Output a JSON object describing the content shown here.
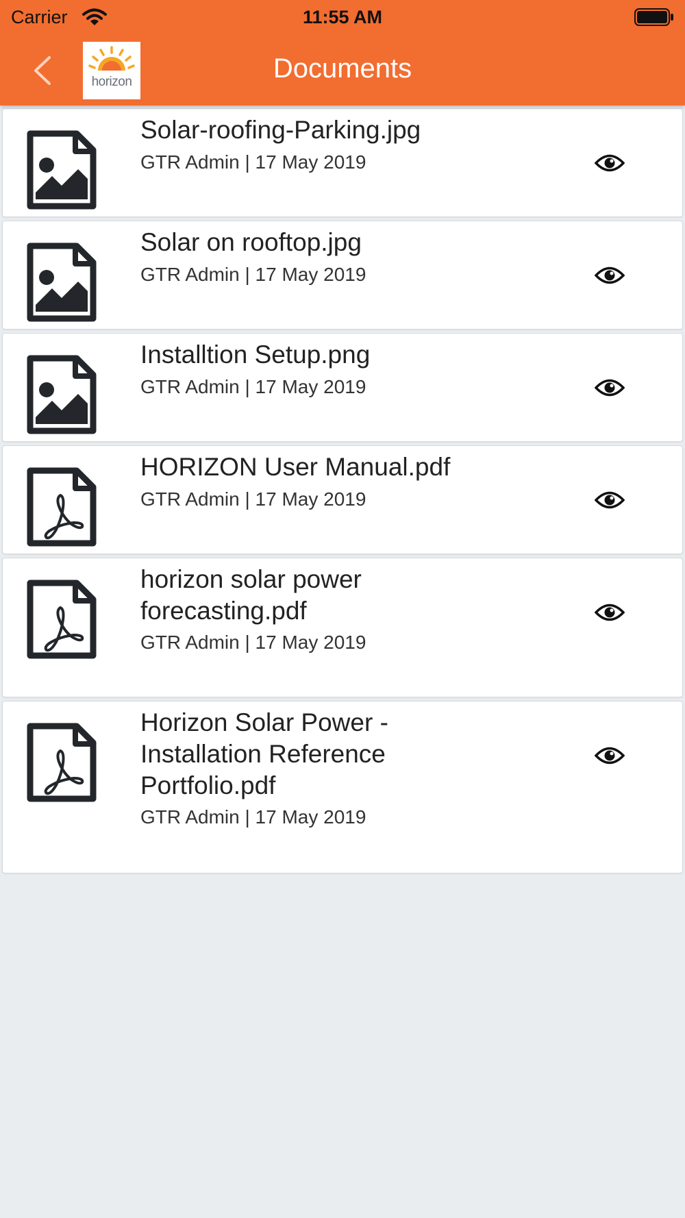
{
  "status_bar": {
    "carrier": "Carrier",
    "time": "11:55 AM"
  },
  "nav": {
    "title": "Documents",
    "logo_text": "horizon"
  },
  "colors": {
    "header": "#f26d30",
    "background": "#e9edf0",
    "icon": "#23272b"
  },
  "documents": [
    {
      "name": "Solar-roofing-Parking.jpg",
      "meta": "GTR Admin | 17 May 2019",
      "icon": "image-file-icon"
    },
    {
      "name": "Solar on rooftop.jpg",
      "meta": "GTR Admin | 17 May 2019",
      "icon": "image-file-icon"
    },
    {
      "name": "Installtion Setup.png",
      "meta": "GTR Admin | 17 May 2019",
      "icon": "image-file-icon"
    },
    {
      "name": "HORIZON User Manual.pdf",
      "meta": "GTR Admin | 17 May 2019",
      "icon": "pdf-file-icon"
    },
    {
      "name": "horizon solar power forecasting.pdf",
      "meta": "GTR Admin | 17 May 2019",
      "icon": "pdf-file-icon"
    },
    {
      "name": "Horizon Solar Power - Installation Reference Portfolio.pdf",
      "meta": "GTR Admin | 17 May 2019",
      "icon": "pdf-file-icon"
    }
  ]
}
